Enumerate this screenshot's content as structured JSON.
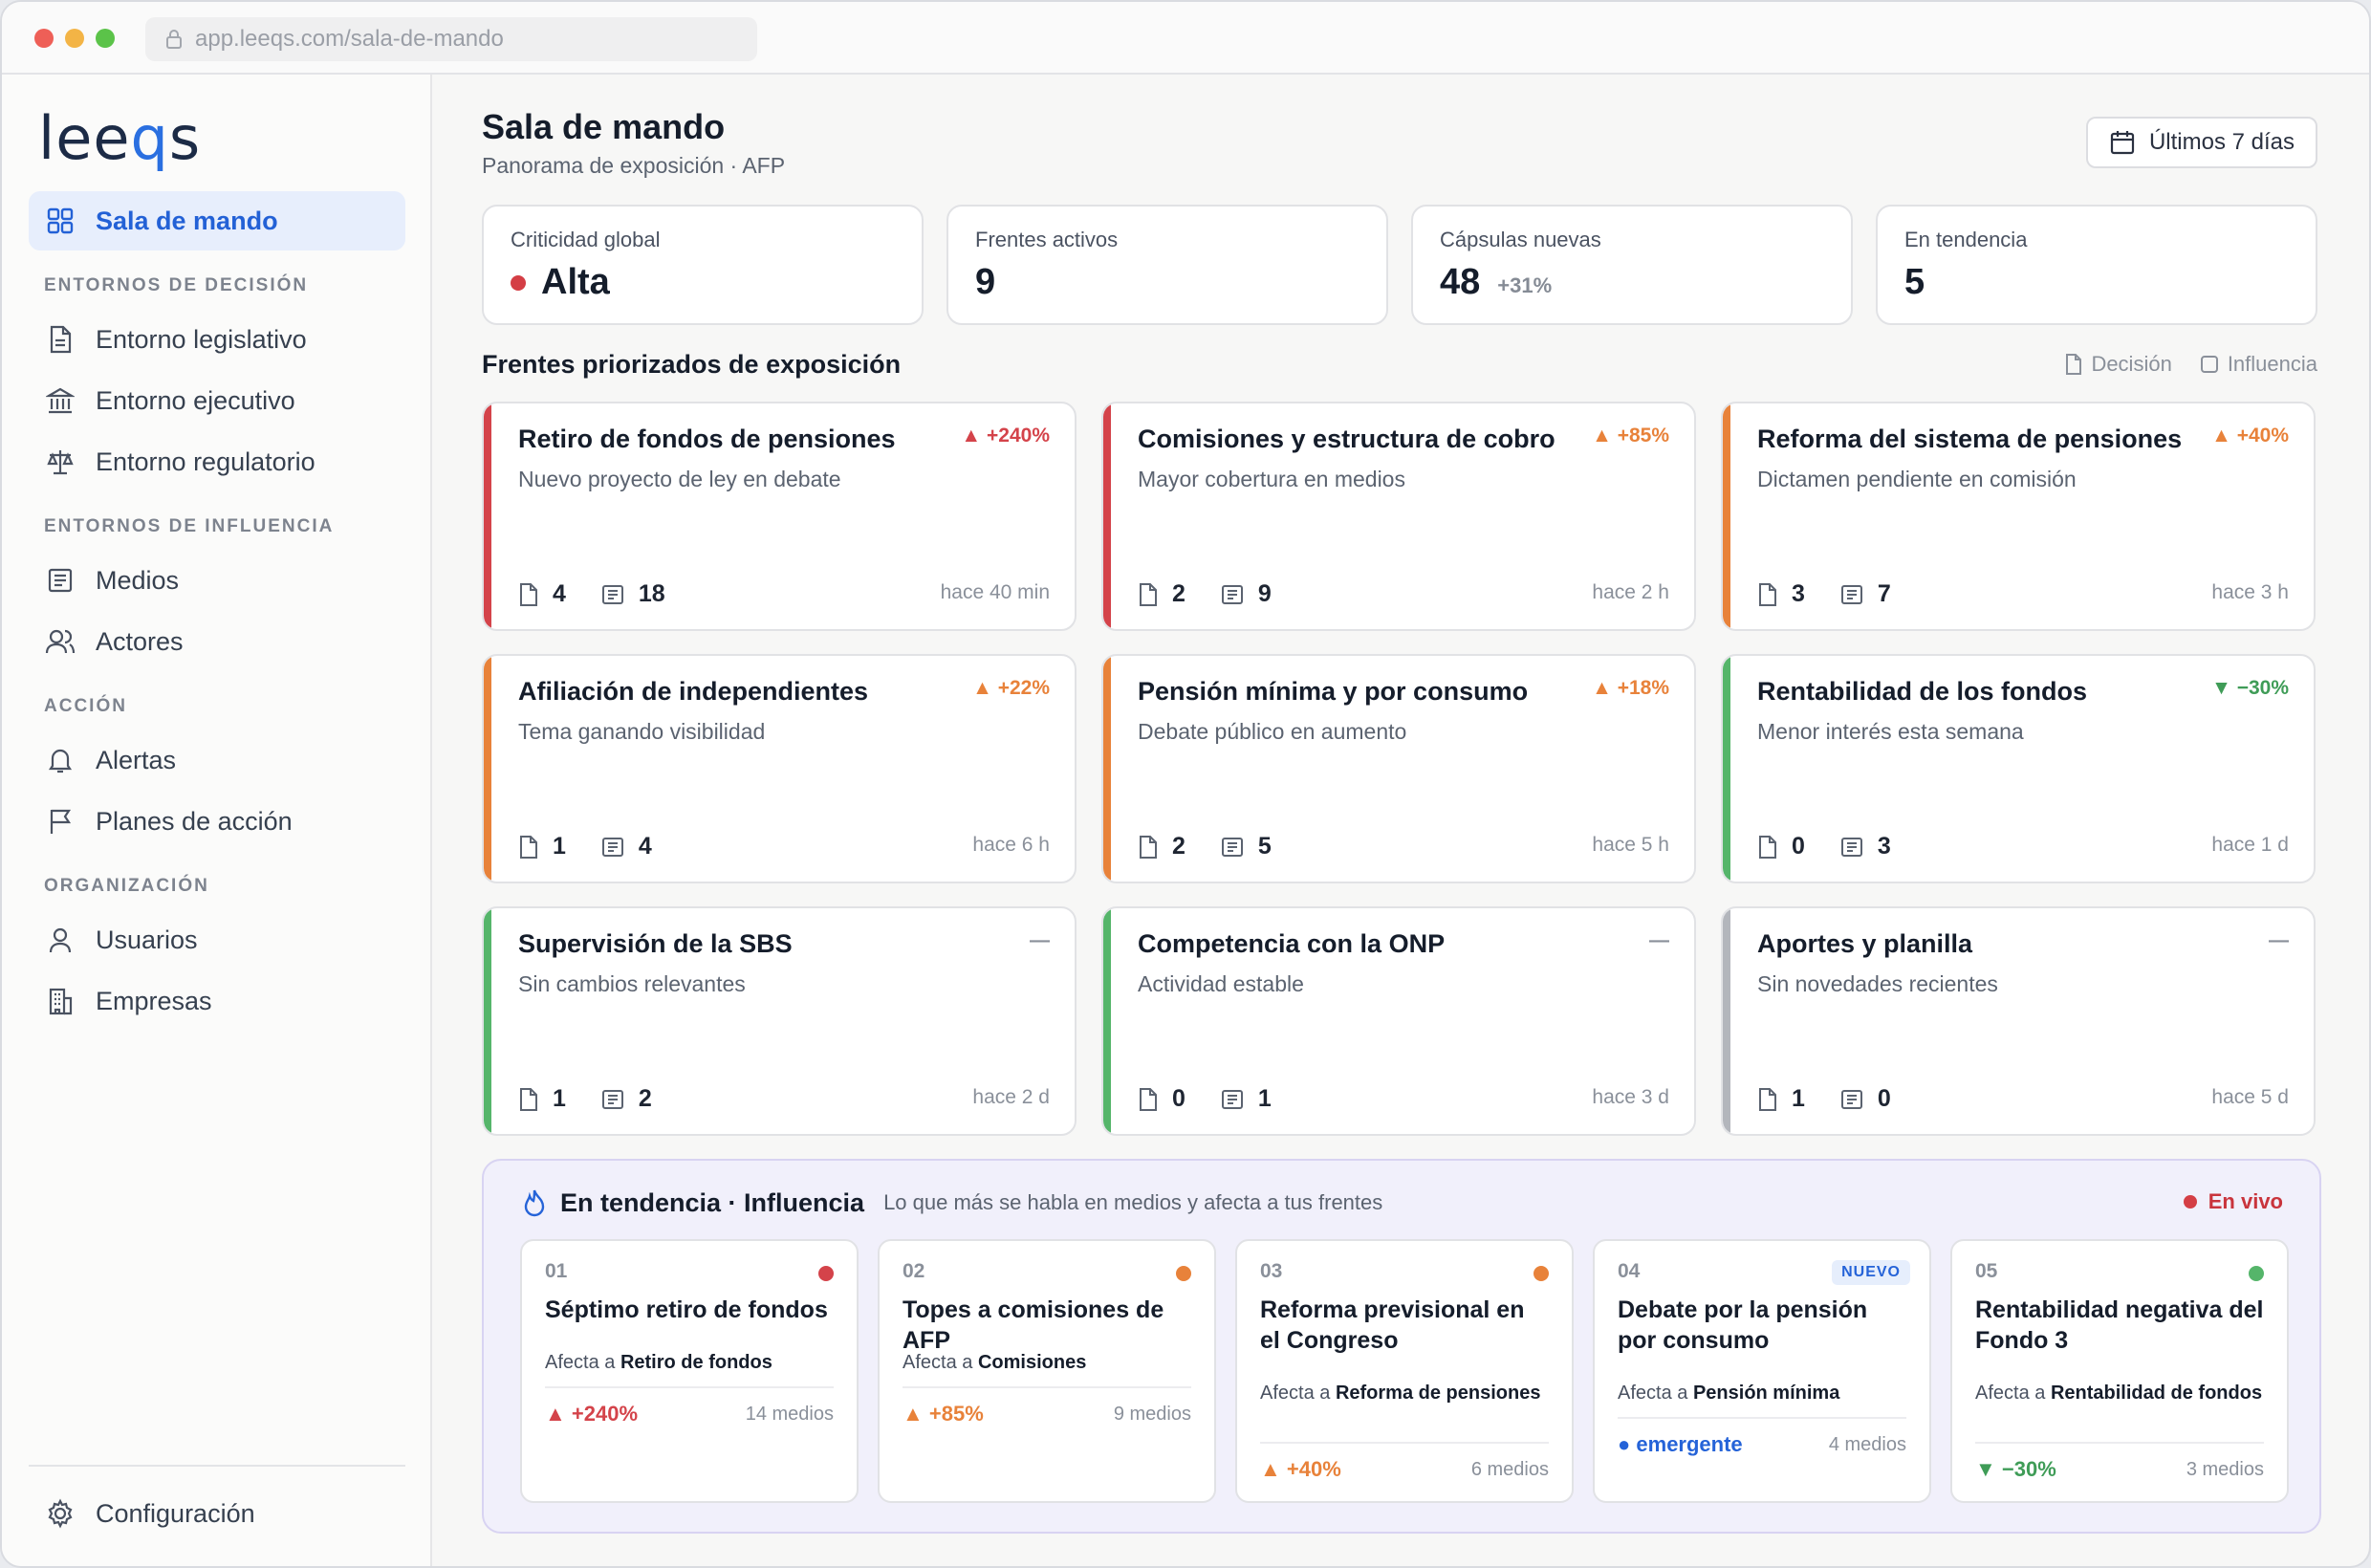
{
  "browser": {
    "url": "app.leeqs.com/sala-de-mando"
  },
  "sidebar": {
    "logo": {
      "pre": "lee",
      "q": "q",
      "post": "s"
    },
    "active_item": "Sala de mando",
    "sections": [
      "ENTORNOS DE DECISIÓN",
      "ENTORNOS DE INFLUENCIA",
      "ACCIÓN",
      "ORGANIZACIÓN"
    ],
    "items": [
      "Entorno legislativo",
      "Entorno ejecutivo",
      "Entorno regulatorio",
      "Medios",
      "Actores",
      "Alertas",
      "Planes de acción",
      "Usuarios",
      "Empresas"
    ],
    "settings": "Configuración"
  },
  "header": {
    "title": "Sala de mando",
    "subtitle": "Panorama de exposición · AFP",
    "range": "Últimos 7 días"
  },
  "kpis": [
    {
      "label": "Criticidad global",
      "value": "Alta",
      "color": "#d43e45"
    },
    {
      "label": "Frentes activos",
      "value": "9"
    },
    {
      "label": "Cápsulas nuevas",
      "value": "48",
      "delta": "+31%"
    },
    {
      "label": "En tendencia",
      "value": "5"
    }
  ],
  "fronts": {
    "title": "Frentes priorizados de exposición",
    "legend": [
      "Decisión",
      "Influencia"
    ],
    "cards": [
      {
        "title": "Retiro de fondos de pensiones",
        "subtitle": "Nuevo proyecto de ley en debate",
        "trend": "▲ +240%",
        "decision": "4",
        "influence": "18",
        "time": "hace 40 min",
        "bar": "#d4434a",
        "trend_color": "#d4434a"
      },
      {
        "title": "Comisiones y estructura de cobro",
        "subtitle": "Mayor cobertura en medios",
        "trend": "▲ +85%",
        "decision": "2",
        "influence": "9",
        "time": "hace 2 h",
        "bar": "#d4434a",
        "trend_color": "#e8823a"
      },
      {
        "title": "Reforma del sistema de pensiones",
        "subtitle": "Dictamen pendiente en comisión",
        "trend": "▲ +40%",
        "decision": "3",
        "influence": "7",
        "time": "hace 3 h",
        "bar": "#e8823a",
        "trend_color": "#e8823a"
      },
      {
        "title": "Afiliación de independientes",
        "subtitle": "Tema ganando visibilidad",
        "trend": "▲ +22%",
        "decision": "1",
        "influence": "4",
        "time": "hace 6 h",
        "bar": "#e8823a",
        "trend_color": "#e8823a"
      },
      {
        "title": "Pensión mínima y por consumo",
        "subtitle": "Debate público en aumento",
        "trend": "▲ +18%",
        "decision": "2",
        "influence": "5",
        "time": "hace 5 h",
        "bar": "#e8823a",
        "trend_color": "#e8823a"
      },
      {
        "title": "Rentabilidad de los fondos",
        "subtitle": "Menor interés esta semana",
        "trend": "▼ −30%",
        "decision": "0",
        "influence": "3",
        "time": "hace 1 d",
        "bar": "#55b56a",
        "trend_color": "#3f9c57"
      },
      {
        "title": "Supervisión de la SBS",
        "subtitle": "Sin cambios relevantes",
        "trend": "—",
        "decision": "1",
        "influence": "2",
        "time": "hace 2 d",
        "bar": "#55b56a",
        "trend_color": "#8a909a"
      },
      {
        "title": "Competencia con la ONP",
        "subtitle": "Actividad estable",
        "trend": "—",
        "decision": "0",
        "influence": "1",
        "time": "hace 3 d",
        "bar": "#55b56a",
        "trend_color": "#8a909a"
      },
      {
        "title": "Aportes y planilla",
        "subtitle": "Sin novedades recientes",
        "trend": "—",
        "decision": "1",
        "influence": "0",
        "time": "hace 5 d",
        "bar": "#b3b6bc",
        "trend_color": "#8a909a"
      }
    ]
  },
  "trending": {
    "title": "En tendencia · Influencia",
    "subtitle": "Lo que más se habla en medios y afecta a tus frentes",
    "live": "En vivo",
    "affects_prefix": "Afecta a",
    "items": [
      {
        "num": "01",
        "title": "Séptimo retiro de fondos",
        "affects": "Retiro de fondos",
        "value": "▲ +240%",
        "media": "14 medios",
        "dot": "#d4434a",
        "value_color": "#d4434a"
      },
      {
        "num": "02",
        "title": "Topes a comisiones de AFP",
        "affects": "Comisiones",
        "value": "▲ +85%",
        "media": "9 medios",
        "dot": "#e8823a",
        "value_color": "#e8823a"
      },
      {
        "num": "03",
        "title": "Reforma previsional en el Congreso",
        "affects": "Reforma de pensiones",
        "value": "▲ +40%",
        "media": "6 medios",
        "dot": "#e8823a",
        "value_color": "#e8823a"
      },
      {
        "num": "04",
        "title": "Debate por la pensión por consumo",
        "affects": "Pensión mínima",
        "value": "● emergente",
        "media": "4 medios",
        "badge": "NUEVO",
        "value_color": "#2563d8"
      },
      {
        "num": "05",
        "title": "Rentabilidad negativa del Fondo 3",
        "affects": "Rentabilidad de fondos",
        "value": "▼ −30%",
        "media": "3 medios",
        "dot": "#55b56a",
        "value_color": "#3f9c57"
      }
    ]
  }
}
